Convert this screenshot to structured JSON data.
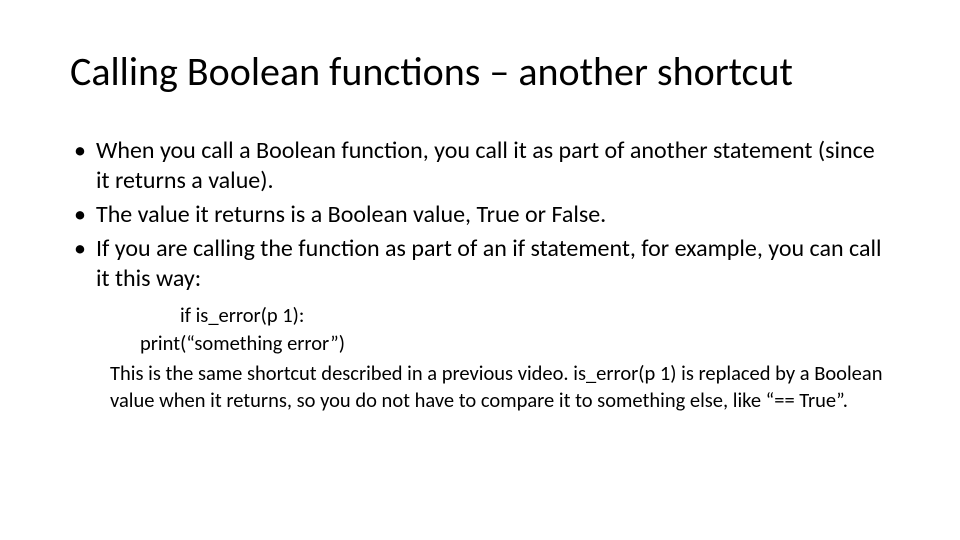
{
  "title": "Calling Boolean functions – another shortcut",
  "bullets": [
    "When you call a Boolean function, you call it as part of another statement (since it returns a value).",
    "The value it returns is a Boolean value, True or False.",
    "If you are calling the function as part of an if statement, for example, you can call it this way:"
  ],
  "code": {
    "line1": "if is_error(p 1):",
    "line2": "print(“something error”)"
  },
  "explain": "This is the same shortcut described in a previous video.  is_error(p 1) is replaced by a Boolean value when it returns, so you do not have to compare it to something else, like “== True”."
}
